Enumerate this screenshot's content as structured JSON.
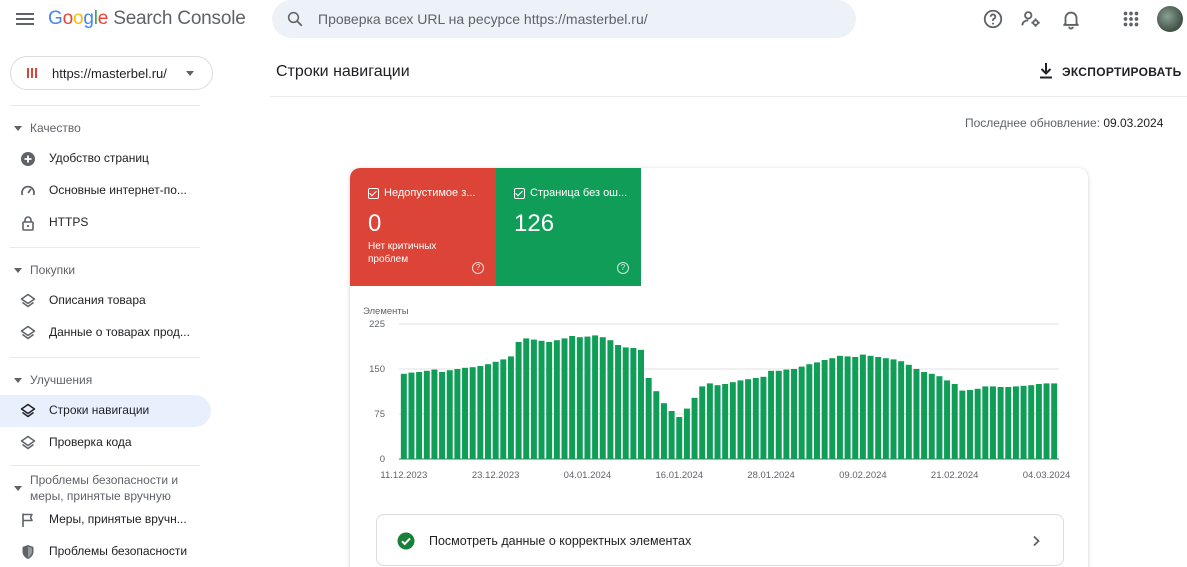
{
  "header": {
    "logo_google": [
      "G",
      "o",
      "o",
      "g",
      "l",
      "e"
    ],
    "logo_product": "Search Console",
    "search_placeholder": "Проверка всех URL на ресурсе https://masterbel.ru/"
  },
  "sidebar": {
    "property": "https://masterbel.ru/",
    "sections": [
      {
        "title": "Качество",
        "items": [
          {
            "label": "Удобство страниц",
            "icon": "plus-circle-icon"
          },
          {
            "label": "Основные интернет-по...",
            "icon": "speed-gauge-icon"
          },
          {
            "label": "HTTPS",
            "icon": "lock-icon"
          }
        ]
      },
      {
        "title": "Покупки",
        "items": [
          {
            "label": "Описания товара",
            "icon": "layers-icon"
          },
          {
            "label": "Данные о товарах прод...",
            "icon": "layers-icon"
          }
        ]
      },
      {
        "title": "Улучшения",
        "items": [
          {
            "label": "Строки навигации",
            "icon": "layers-icon",
            "active": true
          },
          {
            "label": "Проверка кода",
            "icon": "layers-icon"
          }
        ]
      },
      {
        "title_line1": "Проблемы безопасности и",
        "title_line2": "меры, принятые вручную",
        "items": [
          {
            "label": "Меры, принятые вручн...",
            "icon": "flag-icon"
          },
          {
            "label": "Проблемы безопасности",
            "icon": "shield-icon"
          }
        ]
      }
    ]
  },
  "main": {
    "title": "Строки навигации",
    "export_label": "ЭКСПОРТИРОВАТЬ",
    "updated_label": "Последнее обновление:",
    "updated_date": "09.03.2024",
    "tiles": {
      "invalid": {
        "label": "Недопустимое з...",
        "value": "0",
        "sub": "Нет критичных проблем",
        "color": "#db4437"
      },
      "valid": {
        "label": "Страница без ош...",
        "value": "126",
        "color": "#0f9d58"
      }
    },
    "correct_link": "Посмотреть данные о корректных элементах"
  },
  "chart_data": {
    "type": "bar",
    "ylabel": "Элементы",
    "yticks": [
      0,
      75,
      150,
      225
    ],
    "ylim": [
      0,
      225
    ],
    "xtick_labels": [
      "11.12.2023",
      "23.12.2023",
      "04.01.2024",
      "16.01.2024",
      "28.01.2024",
      "09.02.2024",
      "21.02.2024",
      "04.03.2024"
    ],
    "xtick_bar_index": [
      0,
      12,
      24,
      36,
      48,
      60,
      72,
      84
    ],
    "color": "#0f9d58",
    "grid": true,
    "values": [
      142,
      144,
      145,
      147,
      149,
      145,
      148,
      150,
      152,
      153,
      155,
      158,
      162,
      166,
      171,
      195,
      201,
      199,
      197,
      195,
      198,
      201,
      205,
      203,
      204,
      206,
      203,
      198,
      190,
      186,
      185,
      182,
      135,
      113,
      93,
      80,
      70,
      84,
      102,
      121,
      126,
      123,
      125,
      128,
      131,
      133,
      135,
      137,
      147,
      147,
      149,
      150,
      154,
      158,
      161,
      165,
      168,
      172,
      171,
      170,
      174,
      172,
      170,
      168,
      166,
      163,
      157,
      150,
      145,
      142,
      138,
      131,
      125,
      114,
      115,
      117,
      121,
      121,
      120,
      120,
      121,
      122,
      123,
      125,
      126,
      126
    ]
  }
}
